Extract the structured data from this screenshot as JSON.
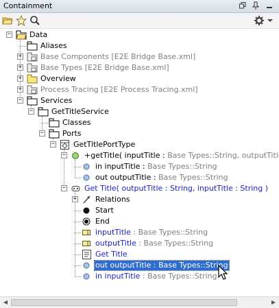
{
  "window": {
    "title": "Containment"
  },
  "toolbar": {
    "icons": [
      "open-folder-icon",
      "star-icon",
      "search-icon"
    ],
    "settings_icon": "gear-icon"
  },
  "tree": [
    {
      "text": "Data",
      "detail": "",
      "textClass": "dark",
      "icon": "package-open",
      "depth": 0,
      "expander": "-"
    },
    {
      "text": "Aliases",
      "detail": "",
      "textClass": "dark",
      "icon": "package",
      "depth": 1,
      "expander": ""
    },
    {
      "text": "Base Components [E2E Bridge Base.xml]",
      "detail": "",
      "textClass": "gray",
      "icon": "package-model",
      "depth": 1,
      "expander": "+"
    },
    {
      "text": "Base Types [E2E Bridge Base.xml]",
      "detail": "",
      "textClass": "gray",
      "icon": "package-model",
      "depth": 1,
      "expander": "+"
    },
    {
      "text": "Overview",
      "detail": "",
      "textClass": "dark",
      "icon": "package-yellow",
      "depth": 1,
      "expander": "+"
    },
    {
      "text": "Process Tracing [E2E Process Tracing.xml]",
      "detail": "",
      "textClass": "gray",
      "icon": "package-model",
      "depth": 1,
      "expander": "+"
    },
    {
      "text": "Services",
      "detail": "",
      "textClass": "dark",
      "icon": "package",
      "depth": 1,
      "expander": "-"
    },
    {
      "text": "GetTitleService",
      "detail": "",
      "textClass": "dark",
      "icon": "package",
      "depth": 2,
      "expander": "-"
    },
    {
      "text": "Classes",
      "detail": "",
      "textClass": "dark",
      "icon": "package",
      "depth": 3,
      "expander": ""
    },
    {
      "text": "Ports",
      "detail": "",
      "textClass": "dark",
      "icon": "package",
      "depth": 3,
      "expander": "-"
    },
    {
      "text": "GetTitlePortType",
      "detail": "",
      "textClass": "dark",
      "icon": "porttype",
      "depth": 4,
      "expander": "-"
    },
    {
      "text": "+getTitle( inputTitle : ",
      "detail": "Base Types::String, outputTitle : B",
      "textClass": "dark",
      "icon": "operation",
      "depth": 5,
      "expander": "-"
    },
    {
      "text": "in inputTitle : ",
      "detail": "Base Types::String",
      "textClass": "dark",
      "icon": "param",
      "depth": 6,
      "expander": ""
    },
    {
      "text": "out outputTitle : ",
      "detail": "Base Types::String",
      "textClass": "dark",
      "icon": "param",
      "depth": 6,
      "expander": ""
    },
    {
      "text": "Get Title( outputTitle : String, inputTitle : String )",
      "detail": "",
      "textClass": "blue",
      "icon": "activity",
      "depth": 5,
      "expander": "-"
    },
    {
      "text": "Relations",
      "detail": "",
      "textClass": "dark",
      "icon": "relations",
      "depth": 6,
      "expander": "+"
    },
    {
      "text": "Start",
      "detail": "",
      "textClass": "dark",
      "icon": "start",
      "depth": 6,
      "expander": ""
    },
    {
      "text": "End",
      "detail": "",
      "textClass": "dark",
      "icon": "end",
      "depth": 6,
      "expander": ""
    },
    {
      "text": "inputTitle",
      "detail": " : Base Types::String",
      "textClass": "blue",
      "icon": "pin",
      "depth": 6,
      "expander": ""
    },
    {
      "text": "outputTitle",
      "detail": " : Base Types::String",
      "textClass": "blue",
      "icon": "pin",
      "depth": 6,
      "expander": ""
    },
    {
      "text": "Get Title",
      "detail": "",
      "textClass": "blue",
      "icon": "action",
      "depth": 6,
      "expander": ""
    },
    {
      "text": "out outputTitle : Base Types::String",
      "detail": "",
      "textClass": "blue",
      "icon": "param",
      "depth": 6,
      "expander": "",
      "selected": true
    },
    {
      "text": "in inputTitle",
      "detail": " : Base Types::String",
      "textClass": "blue",
      "icon": "param",
      "depth": 6,
      "expander": ""
    }
  ]
}
